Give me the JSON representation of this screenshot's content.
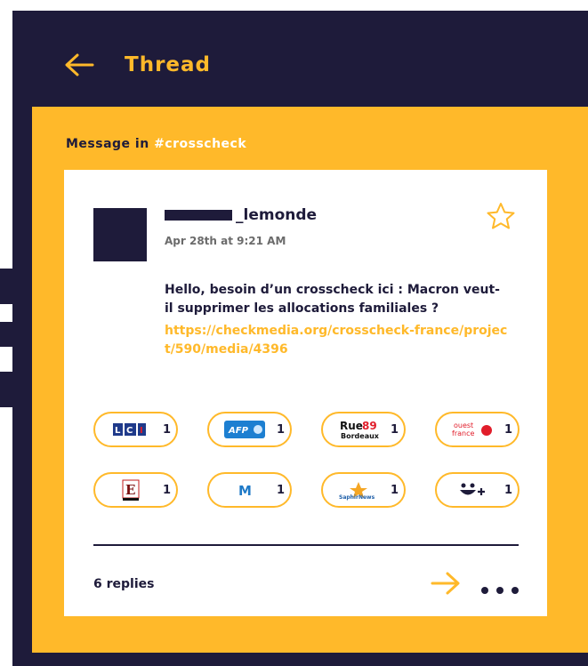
{
  "header": {
    "title": "Thread"
  },
  "panel": {
    "label_prefix": "Message in ",
    "channel": "#crosscheck"
  },
  "message": {
    "username": "_lemonde",
    "timestamp": "Apr 28th at 9:21 AM",
    "text": "Hello, besoin d’un crosscheck ici : Macron veut-il supprimer les allocations familiales ?",
    "link": "https://checkmedia.org/crosscheck-france/project/590/media/4396"
  },
  "reactions": [
    {
      "logo": "LCI",
      "count": "1"
    },
    {
      "logo": "AFP",
      "count": "1"
    },
    {
      "logo": "Rue89 Bordeaux",
      "count": "1"
    },
    {
      "logo": "ouest france",
      "count": "1"
    },
    {
      "logo": "E",
      "count": "1"
    },
    {
      "logo": "M",
      "count": "1"
    },
    {
      "logo": "SaphirNews",
      "count": "1"
    },
    {
      "logo": "add-reaction",
      "count": "1"
    }
  ],
  "footer": {
    "replies": "6 replies"
  },
  "colors": {
    "navy": "#1e1b3a",
    "accent": "#ffb92a"
  }
}
